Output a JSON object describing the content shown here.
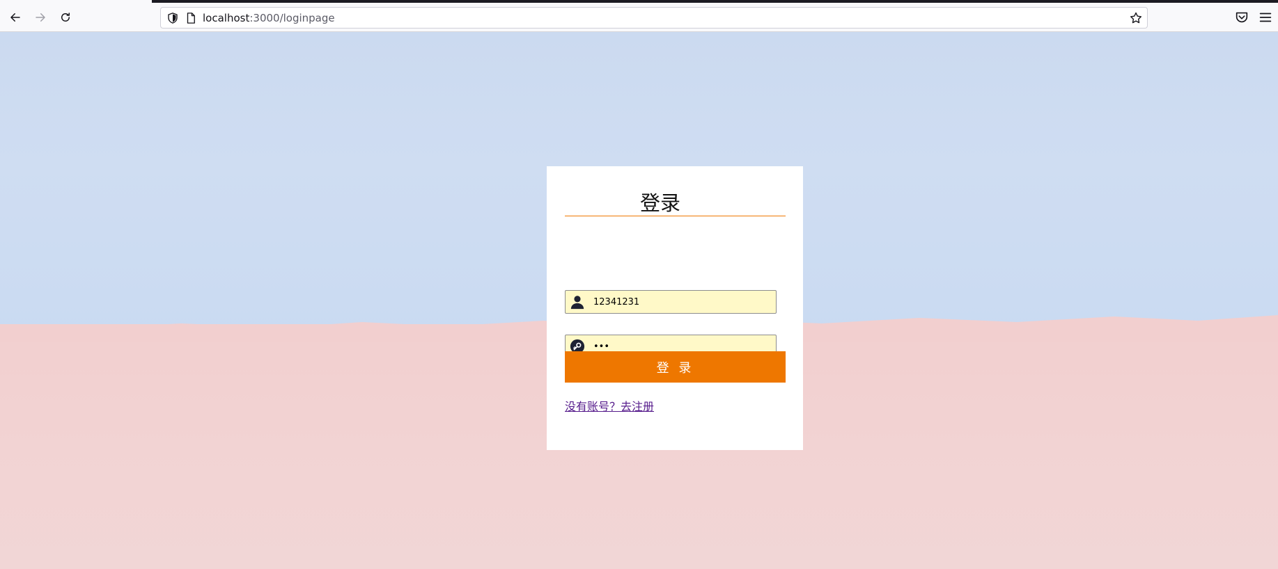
{
  "browser": {
    "url_host": "localhost",
    "url_path": ":3000/loginpage"
  },
  "login": {
    "title": "登录",
    "username_value": "12341231",
    "password_value": "•••",
    "submit_label": "登 录",
    "register_link": "没有账号？去注册"
  },
  "colors": {
    "accent": "#ee7700",
    "input_bg": "#fff9c8",
    "sky": "#cbdaf0",
    "ground": "#f2d3d3"
  },
  "icons": {
    "username": "user-icon",
    "password": "key-icon"
  }
}
